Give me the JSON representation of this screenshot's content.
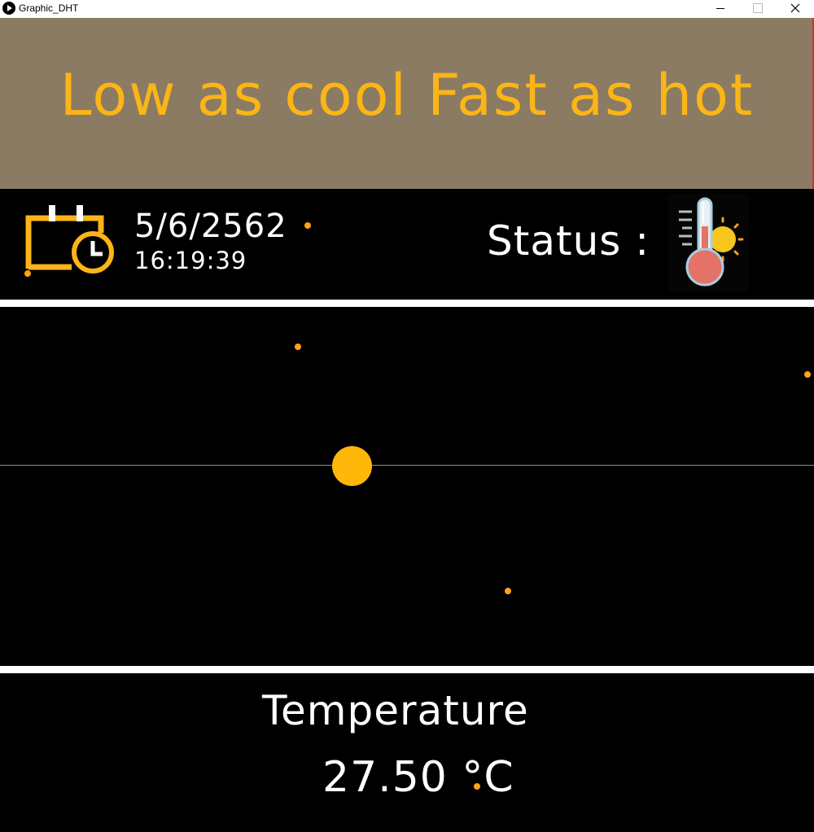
{
  "window": {
    "title": "Graphic_DHT"
  },
  "banner": {
    "text": "Low as cool Fast as hot"
  },
  "info": {
    "date": "5/6/2562",
    "time": "16:19:39",
    "status_label": "Status :"
  },
  "readout": {
    "label": "Temperature",
    "value": "27.50 °C"
  },
  "colors": {
    "banner_bg": "#8b7b62",
    "accent_orange": "#fbb517",
    "background": "#000000",
    "text": "#ffffff"
  },
  "icons": {
    "calendar": "calendar-clock-icon",
    "status": "thermometer-sun-icon"
  }
}
